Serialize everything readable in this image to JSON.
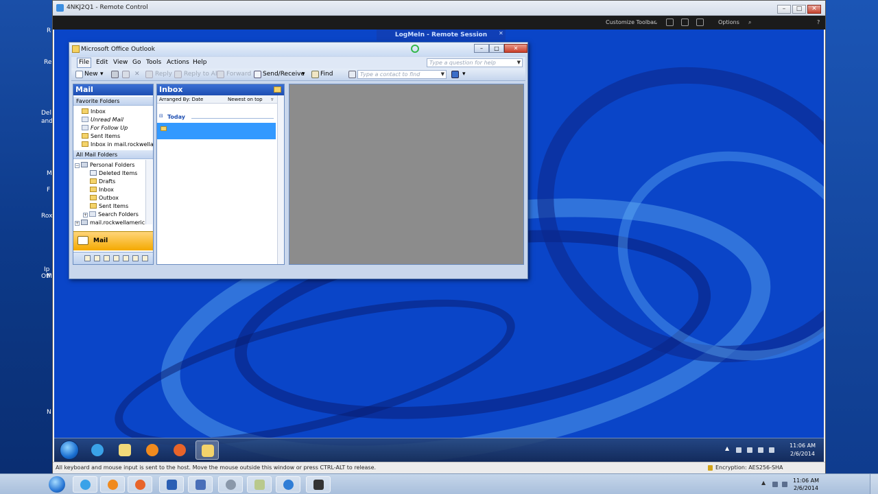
{
  "host": {
    "left_labels": [
      "R",
      "Re",
      "Del",
      "and",
      "M",
      "F",
      "Rox",
      "Ip",
      "M",
      "Off",
      "N"
    ],
    "taskbar_apps": [
      "ie",
      "media-player",
      "firefox",
      "word",
      "remote",
      "chrome",
      "notes",
      "logmein",
      "tool"
    ],
    "clock_time": "11:06 AM",
    "clock_date": "2/6/2014"
  },
  "logmein": {
    "title": "4NKJ2Q1 - Remote Control",
    "toolbar": {
      "customize": "Customize Toolbar",
      "options": "Options"
    },
    "banner": "LogMeIn - Remote Session",
    "status_left": "All keyboard and mouse input is sent to the host. Move the mouse outside this window or press CTRL-ALT to release.",
    "status_right": "Encryption: AES256-SHA"
  },
  "outlook": {
    "title": "Microsoft Office Outlook",
    "menu": [
      "File",
      "Edit",
      "View",
      "Go",
      "Tools",
      "Actions",
      "Help"
    ],
    "help_placeholder": "Type a question for help",
    "toolbar": {
      "new": "New",
      "reply": "Reply",
      "reply_all": "Reply to All",
      "forward": "Forward",
      "send_receive": "Send/Receive",
      "find": "Find",
      "contact_placeholder": "Type a contact to find"
    },
    "nav": {
      "header": "Mail",
      "favorites_header": "Favorite Folders",
      "favorites": [
        "Inbox",
        "Unread Mail",
        "For Follow Up",
        "Sent Items",
        "Inbox in mail.rockwellame"
      ],
      "all_header": "All Mail Folders",
      "personal": "Personal Folders",
      "folders": [
        "Deleted Items",
        "Drafts",
        "Inbox",
        "Outbox",
        "Sent Items",
        "Search Folders"
      ],
      "account": "mail.rockwellamerican.",
      "mail_button": "Mail"
    },
    "inbox": {
      "header": "Inbox",
      "arranged_by": "Arranged By: Date",
      "sort": "Newest on top",
      "group": "Today"
    }
  },
  "remote_taskbar": {
    "clock_time": "11:06 AM",
    "clock_date": "2/6/2014"
  },
  "colors": {
    "desktop_blue": "#0a45c8",
    "outlook_header": "#1d4eb2",
    "selection": "#3399ff",
    "mail_button": "#f4a900",
    "reading_pane": "#8c8c8c"
  }
}
